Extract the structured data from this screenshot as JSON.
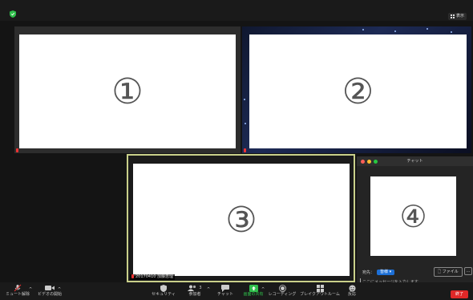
{
  "top": {
    "view_label": "表示"
  },
  "tiles": [
    {
      "number": "①",
      "name": ""
    },
    {
      "number": "②",
      "name": ""
    },
    {
      "number": "③",
      "name": "20170410 加藤恵理"
    }
  ],
  "chat": {
    "title": "チャット",
    "number": "④",
    "to_label": "宛先：",
    "to_value": "皆様",
    "file_label": "ファイル",
    "more_label": "…",
    "placeholder": "ここにメッセージを入力します..."
  },
  "toolbar": {
    "items": [
      {
        "label": "ミュート解除",
        "icon": "mic-muted-icon"
      },
      {
        "label": "ビデオの開始",
        "icon": "video-icon"
      },
      {
        "label": "セキュリティ",
        "icon": "shield-icon"
      },
      {
        "label": "参加者",
        "icon": "participants-icon",
        "count": "3"
      },
      {
        "label": "チャット",
        "icon": "chat-icon"
      },
      {
        "label": "画面の共有",
        "icon": "share-screen-icon"
      },
      {
        "label": "レコーディング",
        "icon": "record-icon"
      },
      {
        "label": "ブレイクアウトルーム",
        "icon": "breakout-icon"
      },
      {
        "label": "反応",
        "icon": "reaction-icon"
      }
    ],
    "end_label": "終了"
  },
  "colors": {
    "share_green": "#2fbe4b",
    "end_red": "#e02828",
    "active_border": "#c9d08a"
  }
}
